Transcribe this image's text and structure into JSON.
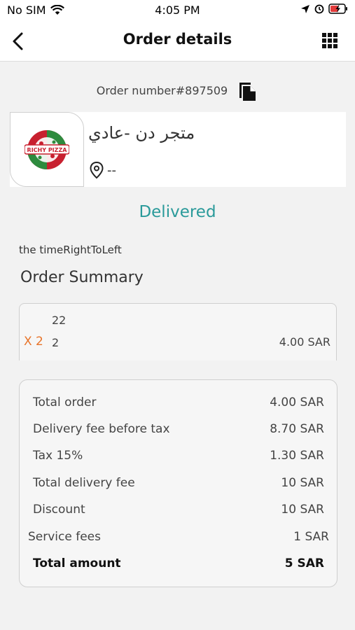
{
  "status_bar": {
    "carrier": "No SIM",
    "time": "4:05 PM"
  },
  "header": {
    "title": "Order details"
  },
  "order": {
    "number_label": "Order number#",
    "number": "897509"
  },
  "store": {
    "name": "متجر دن -عادي",
    "location": "--",
    "logo_text": "RICHY PIZZA"
  },
  "status": "Delivered",
  "time_label": "the timeRightToLeft",
  "summary": {
    "title": "Order Summary",
    "items": [
      {
        "note": "22",
        "qty": "X 2",
        "name": "2",
        "price": "4.00 SAR"
      }
    ]
  },
  "totals": [
    {
      "label": "Total order",
      "value": "4.00  SAR"
    },
    {
      "label": "Delivery fee before tax",
      "value": "8.70  SAR"
    },
    {
      "label": "Tax 15%",
      "value": "1.30  SAR"
    },
    {
      "label": "Total delivery fee",
      "value": "10  SAR"
    },
    {
      "label": "Discount",
      "value": "10  SAR"
    },
    {
      "label": "Service fees",
      "value": "1  SAR"
    },
    {
      "label": "Total amount",
      "value": "5  SAR"
    }
  ],
  "colors": {
    "status": "#2a9a9a",
    "quantity": "#e8742a",
    "logo_red": "#c8202f",
    "logo_green": "#2e8b3e"
  },
  "icons": [
    "back-arrow-icon",
    "grid-menu-icon",
    "copy-icon",
    "location-pin-icon",
    "wifi-icon",
    "location-arrow-icon",
    "battery-icon"
  ]
}
